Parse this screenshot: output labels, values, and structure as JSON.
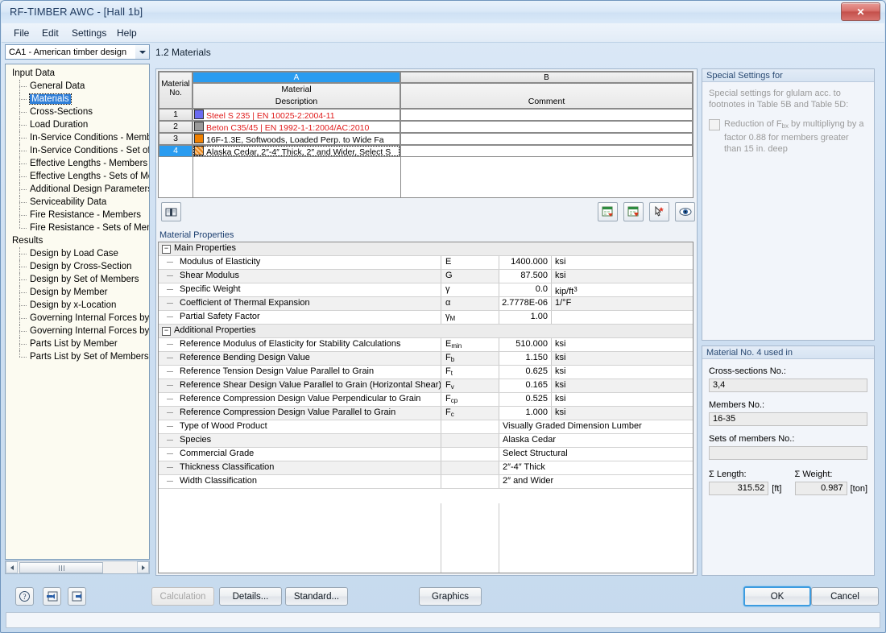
{
  "window": {
    "title": "RF-TIMBER AWC - [Hall 1b]",
    "close_label": "✕"
  },
  "menu": [
    "File",
    "Edit",
    "Settings",
    "Help"
  ],
  "sidebar": {
    "combo_value": "CA1 - American timber design",
    "groups": [
      {
        "label": "Input Data",
        "items": [
          "General Data",
          "Materials",
          "Cross-Sections",
          "Load Duration",
          "In-Service Conditions - Members",
          "In-Service Conditions - Set of M",
          "Effective Lengths - Members",
          "Effective Lengths - Sets of Mem",
          "Additional Design Parameters",
          "Serviceability Data",
          "Fire Resistance - Members",
          "Fire Resistance - Sets of Memb"
        ],
        "selected": "Materials"
      },
      {
        "label": "Results",
        "items": [
          "Design by Load Case",
          "Design by Cross-Section",
          "Design by Set of Members",
          "Design by Member",
          "Design by x-Location",
          "Governing Internal Forces by M",
          "Governing Internal Forces by Se",
          "Parts List by Member",
          "Parts List by Set of Members"
        ],
        "selected": null
      }
    ]
  },
  "main": {
    "tab_label": "1.2 Materials",
    "materials_table": {
      "col_letters": [
        "A",
        "B"
      ],
      "row_header": "Material\nNo.",
      "row_header_line1": "Material",
      "row_header_line2": "No.",
      "headers": [
        "Material",
        "Description",
        "Comment"
      ],
      "header_a_line1": "Material",
      "header_a_line2": "Description",
      "header_b": "Comment",
      "rows": [
        {
          "no": "1",
          "swatch": "#6b6bf0",
          "swatch_type": "solid",
          "description": "Steel S 235 | EN 10025-2:2004-11",
          "color": "#e01b1b",
          "comment": "",
          "selected": false
        },
        {
          "no": "2",
          "swatch": "#9a9a9a",
          "swatch_type": "solid",
          "description": "Beton C35/45 | EN 1992-1-1:2004/AC:2010",
          "color": "#e01b1b",
          "comment": "",
          "selected": false
        },
        {
          "no": "3",
          "swatch": "#f08000",
          "swatch_type": "solid",
          "description": "16F-1.3E, Softwoods, Loaded Perp. to Wide Fa",
          "color": "#000000",
          "comment": "",
          "selected": false
        },
        {
          "no": "4",
          "swatch": "#e8861c",
          "swatch_type": "hatch",
          "description": "Alaska Cedar, 2″-4″ Thick, 2″ and Wider, Select S",
          "color": "#000000",
          "comment": "",
          "selected": true
        }
      ]
    },
    "table_toolbar": {
      "library_icon": "library-book-icon",
      "import_icon": "excel-import-icon",
      "export_icon": "excel-export-icon",
      "pick_icon": "pick-material-icon",
      "view_icon": "eye-visibility-icon"
    },
    "properties_title": "Material Properties",
    "property_groups": [
      {
        "label": "Main Properties",
        "expander": "−",
        "rows": [
          {
            "name": "Modulus of Elasticity",
            "symbol": "E",
            "sym_sub": "",
            "value": "1400.000",
            "unit": "ksi",
            "kind": "numeric"
          },
          {
            "name": "Shear Modulus",
            "symbol": "G",
            "sym_sub": "",
            "value": "87.500",
            "unit": "ksi",
            "kind": "numeric"
          },
          {
            "name": "Specific Weight",
            "symbol": "γ",
            "sym_sub": "",
            "value": "0.0",
            "unit": "kip/ft³",
            "kind": "numeric"
          },
          {
            "name": "Coefficient of Thermal Expansion",
            "symbol": "α",
            "sym_sub": "",
            "value": "2.7778E-06",
            "unit": "1/°F",
            "kind": "numeric"
          },
          {
            "name": "Partial Safety Factor",
            "symbol": "γ",
            "sym_sub": "M",
            "value": "1.00",
            "unit": "",
            "kind": "numeric"
          }
        ]
      },
      {
        "label": "Additional Properties",
        "expander": "−",
        "rows": [
          {
            "name": "Reference Modulus of Elasticity for Stability Calculations",
            "symbol": "E",
            "sym_sub": "min",
            "value": "510.000",
            "unit": "ksi",
            "kind": "numeric"
          },
          {
            "name": "Reference Bending Design Value",
            "symbol": "F",
            "sym_sub": "b",
            "value": "1.150",
            "unit": "ksi",
            "kind": "numeric"
          },
          {
            "name": "Reference Tension Design Value Parallel to Grain",
            "symbol": "F",
            "sym_sub": "t",
            "value": "0.625",
            "unit": "ksi",
            "kind": "numeric"
          },
          {
            "name": "Reference Shear Design Value Parallel to Grain (Horizontal Shear)",
            "symbol": "F",
            "sym_sub": "v",
            "value": "0.165",
            "unit": "ksi",
            "kind": "numeric"
          },
          {
            "name": "Reference Compression Design Value Perpendicular to Grain",
            "symbol": "F",
            "sym_sub": "cp",
            "value": "0.525",
            "unit": "ksi",
            "kind": "numeric"
          },
          {
            "name": "Reference Compression Design Value Parallel to Grain",
            "symbol": "F",
            "sym_sub": "c",
            "value": "1.000",
            "unit": "ksi",
            "kind": "numeric"
          },
          {
            "name": "Type of Wood Product",
            "symbol": "",
            "sym_sub": "",
            "value": "Visually Graded Dimension Lumber",
            "unit": "",
            "kind": "text"
          },
          {
            "name": "Species",
            "symbol": "",
            "sym_sub": "",
            "value": "Alaska Cedar",
            "unit": "",
            "kind": "text"
          },
          {
            "name": "Commercial Grade",
            "symbol": "",
            "sym_sub": "",
            "value": "Select Structural",
            "unit": "",
            "kind": "text"
          },
          {
            "name": "Thickness Classification",
            "symbol": "",
            "sym_sub": "",
            "value": "2″-4″ Thick",
            "unit": "",
            "kind": "text"
          },
          {
            "name": "Width Classification",
            "symbol": "",
            "sym_sub": "",
            "value": "2″ and Wider",
            "unit": "",
            "kind": "text"
          }
        ]
      }
    ]
  },
  "right": {
    "special": {
      "header": "Special Settings for",
      "description": "Special settings for glulam acc. to footnotes in Table 5B and Table 5D:",
      "checkbox_label_1": "Reduction of F",
      "checkbox_label_sub": "bx",
      "checkbox_label_2": " by multipliyng by a factor 0.88 for members greater than 15 in. deep",
      "checked": false
    },
    "usage": {
      "header": "Material No. 4 used in",
      "cross_sections_label": "Cross-sections No.:",
      "cross_sections_value": "3,4",
      "members_label": "Members No.:",
      "members_value": "16-35",
      "sets_label": "Sets of members No.:",
      "sets_value": "",
      "length_label": "Σ Length:",
      "length_value": "315.52",
      "length_unit": "[ft]",
      "weight_label": "Σ Weight:",
      "weight_value": "0.987",
      "weight_unit": "[ton]"
    }
  },
  "footer": {
    "help_icon": "help-question-icon",
    "prev_icon": "previous-arrow-icon",
    "next_icon": "next-arrow-icon",
    "calculation": "Calculation",
    "details": "Details...",
    "standard": "Standard...",
    "graphics": "Graphics",
    "ok": "OK",
    "cancel": "Cancel"
  }
}
